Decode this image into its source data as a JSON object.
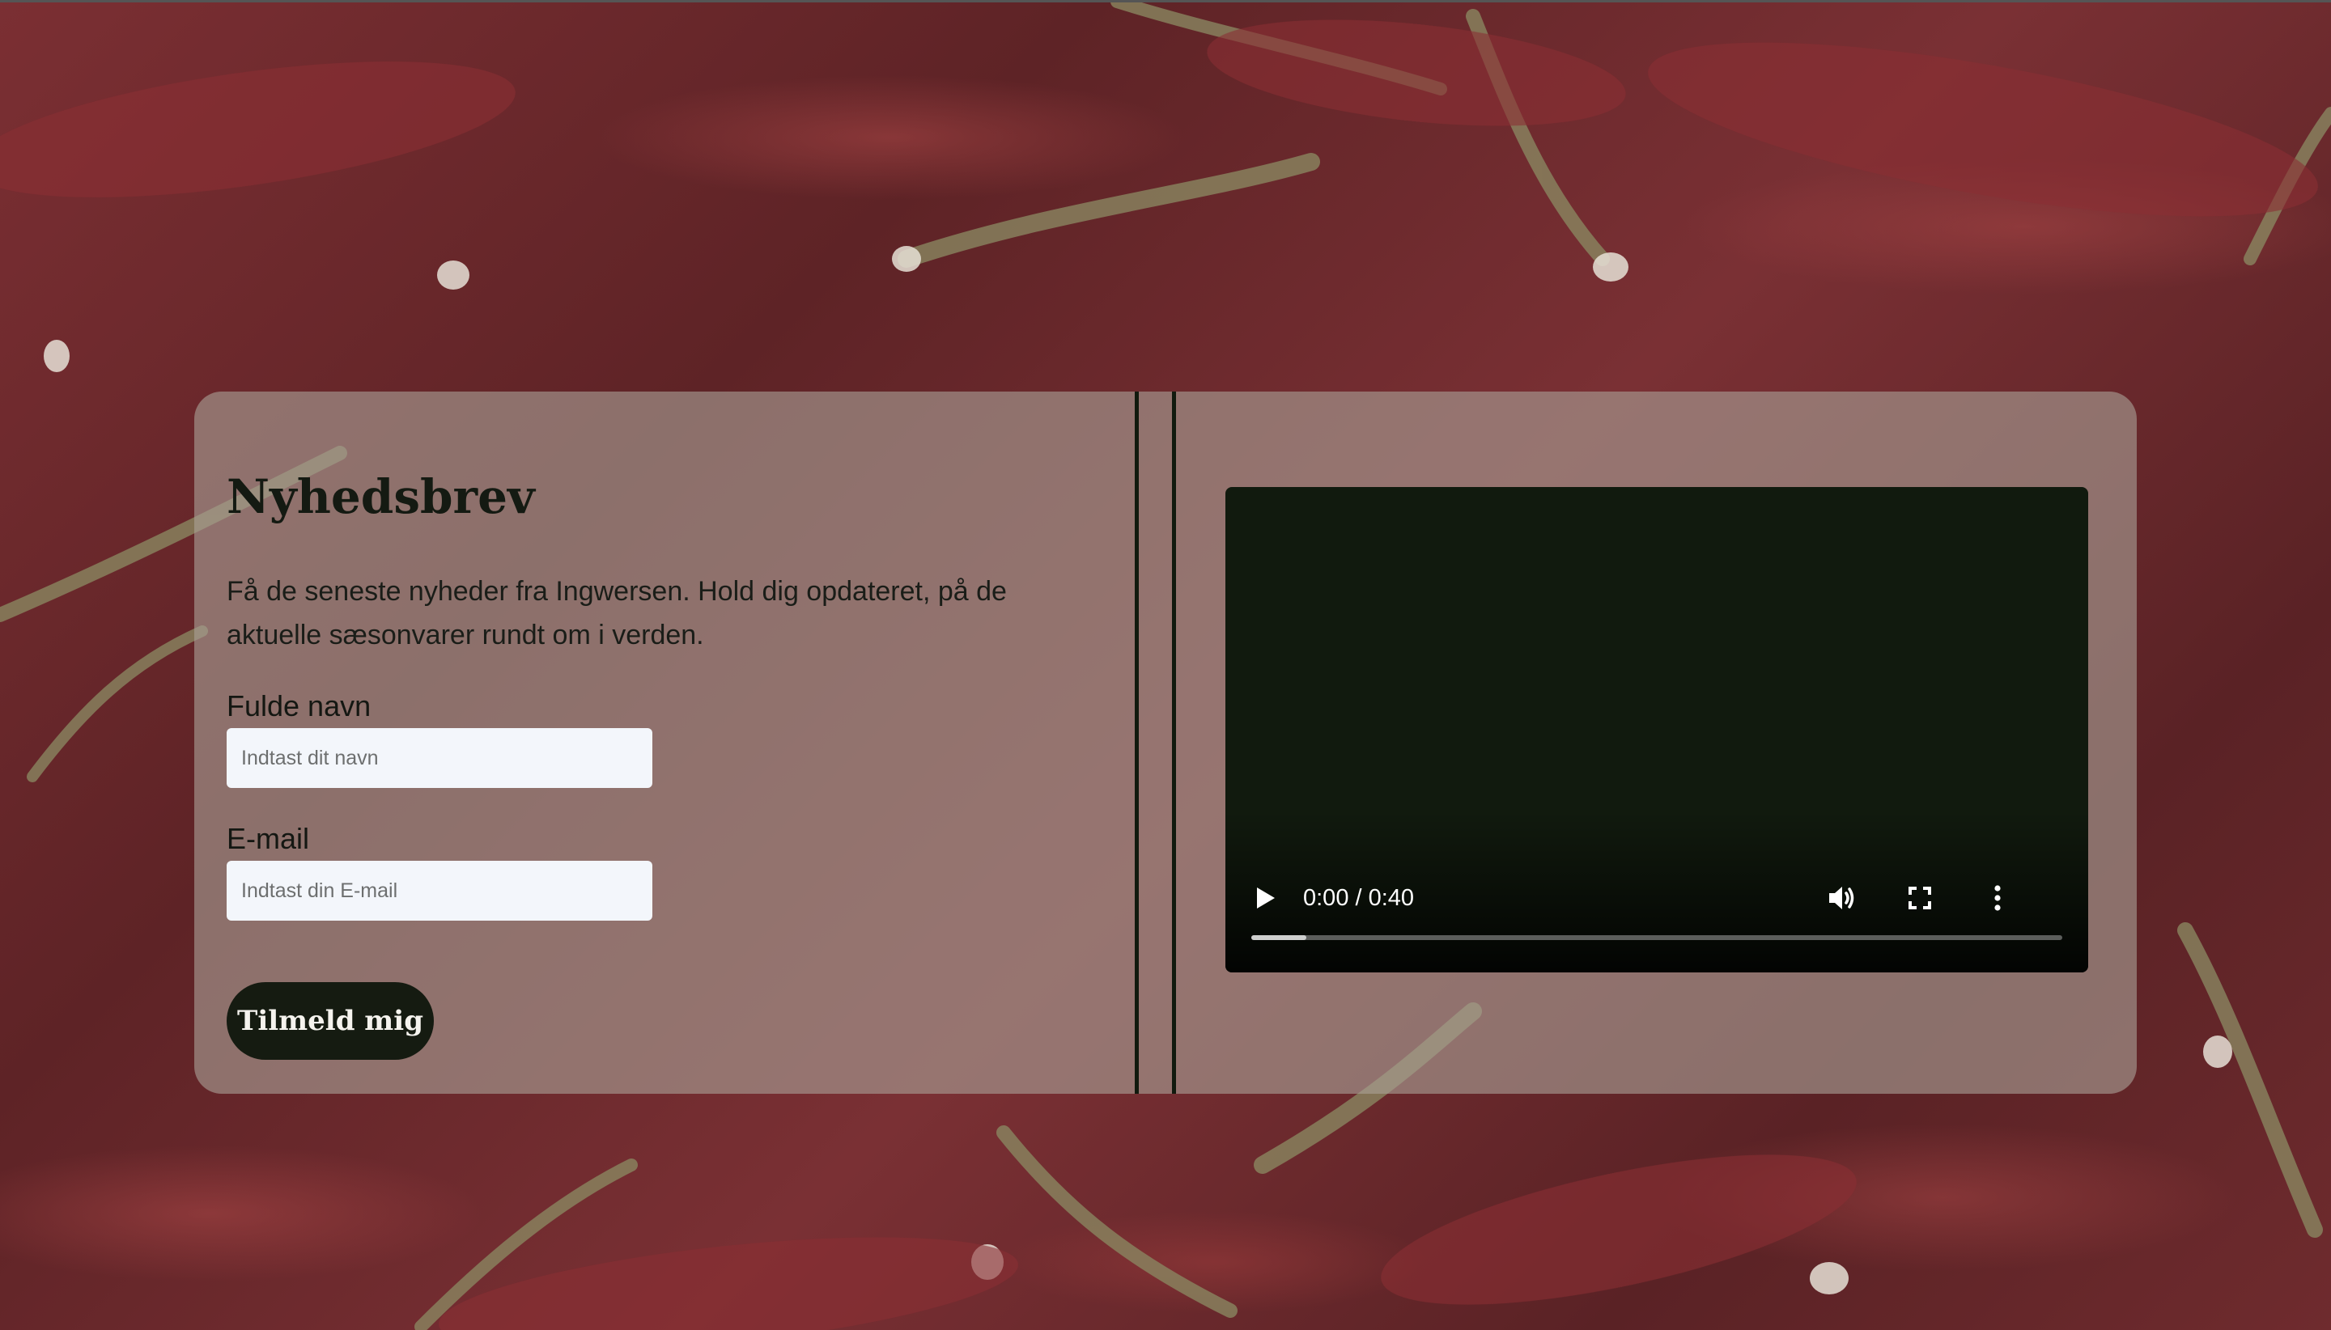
{
  "newsletter": {
    "title": "Nyhedsbrev",
    "intro": "Få de seneste nyheder fra Ingwersen. Hold dig opdateret, på de aktuelle sæsonvarer rundt om i verden.",
    "name_label": "Fulde navn",
    "name_placeholder": "Indtast dit navn",
    "email_label": "E-mail",
    "email_placeholder": "Indtast din E-mail",
    "submit_label": "Tilmeld mig"
  },
  "video": {
    "time_display": "0:00 / 0:40",
    "progress": 0,
    "controls": [
      "play-icon",
      "volume-icon",
      "fullscreen-icon",
      "more-options-icon"
    ]
  },
  "colors": {
    "card_background": "#aaa096",
    "dark_green": "#151b11",
    "video_background": "#111a0e",
    "input_background": "#f3f6fb",
    "background_red": "#6e2a2e"
  }
}
